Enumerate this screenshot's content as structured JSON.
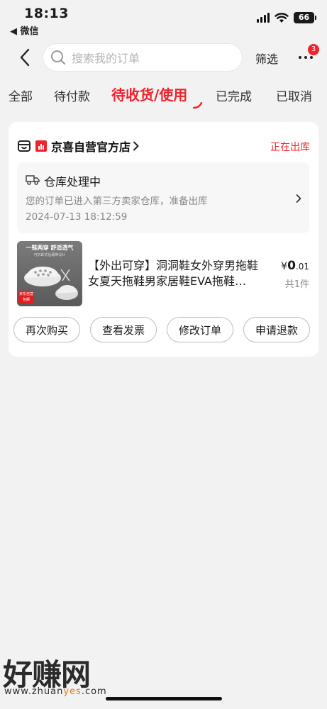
{
  "status_bar": {
    "time": "18:13",
    "back_app": "◀ 微信",
    "battery": "66"
  },
  "header": {
    "search_placeholder": "搜索我的订单",
    "filter_label": "筛选",
    "more_badge": "3"
  },
  "tabs": [
    {
      "label": "全部",
      "active": false
    },
    {
      "label": "待付款",
      "active": false
    },
    {
      "label": "待收货/使用",
      "active": true
    },
    {
      "label": "已完成",
      "active": false
    },
    {
      "label": "已取消",
      "active": false
    }
  ],
  "order": {
    "store_name": "京喜自营官方店",
    "status": "正在出库",
    "logistics": {
      "title": "仓库处理中",
      "description": "您的订单已进入第三方卖家仓库，准备出库",
      "time": "2024-07-13 18:12:59"
    },
    "product": {
      "title_line1": "【外出可穿】洞洞鞋女外穿男拖鞋",
      "title_line2": "女夏天拖鞋男家居鞋EVA拖鞋…",
      "image_text_top": "一鞋两穿 舒适透气",
      "image_text_sub": "可拆卸式后跟带设计",
      "image_tag": "京东自营 包邮",
      "price_symbol": "¥",
      "price_int": "0",
      "price_dec": ".01",
      "quantity": "共1件"
    },
    "actions": [
      "再次购买",
      "查看发票",
      "修改订单",
      "申请退款"
    ]
  },
  "watermark": {
    "logo": "好赚网",
    "url_prefix": "www.zhuan",
    "url_highlight": "yes",
    "url_suffix": ".com"
  },
  "colors": {
    "accent": "#f0232d",
    "background": "#f2f2f2",
    "card": "#ffffff"
  }
}
